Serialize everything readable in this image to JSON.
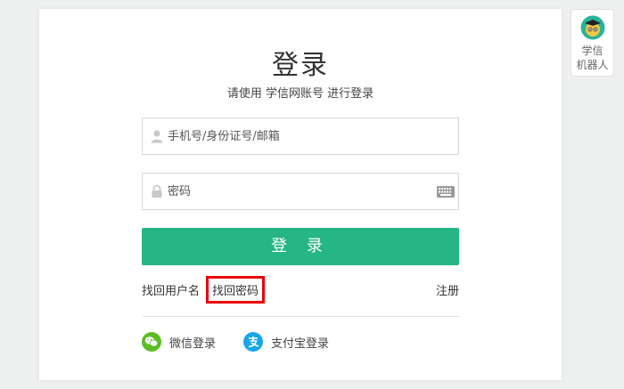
{
  "login": {
    "title": "登录",
    "subtitle": "请使用 学信网账号 进行登录",
    "username_placeholder": "手机号/身份证号/邮箱",
    "password_placeholder": "密码",
    "submit_label": "登 录"
  },
  "links": {
    "forgot_username": "找回用户名",
    "forgot_password": "找回密码",
    "register": "注册"
  },
  "social": {
    "wechat_label": "微信登录",
    "alipay_label": "支付宝登录"
  },
  "robot": {
    "line1": "学信",
    "line2": "机器人"
  },
  "colors": {
    "primary": "#26b584",
    "highlight_box": "#e8000b",
    "wechat": "#5bbd23",
    "alipay": "#1aa6e6"
  }
}
